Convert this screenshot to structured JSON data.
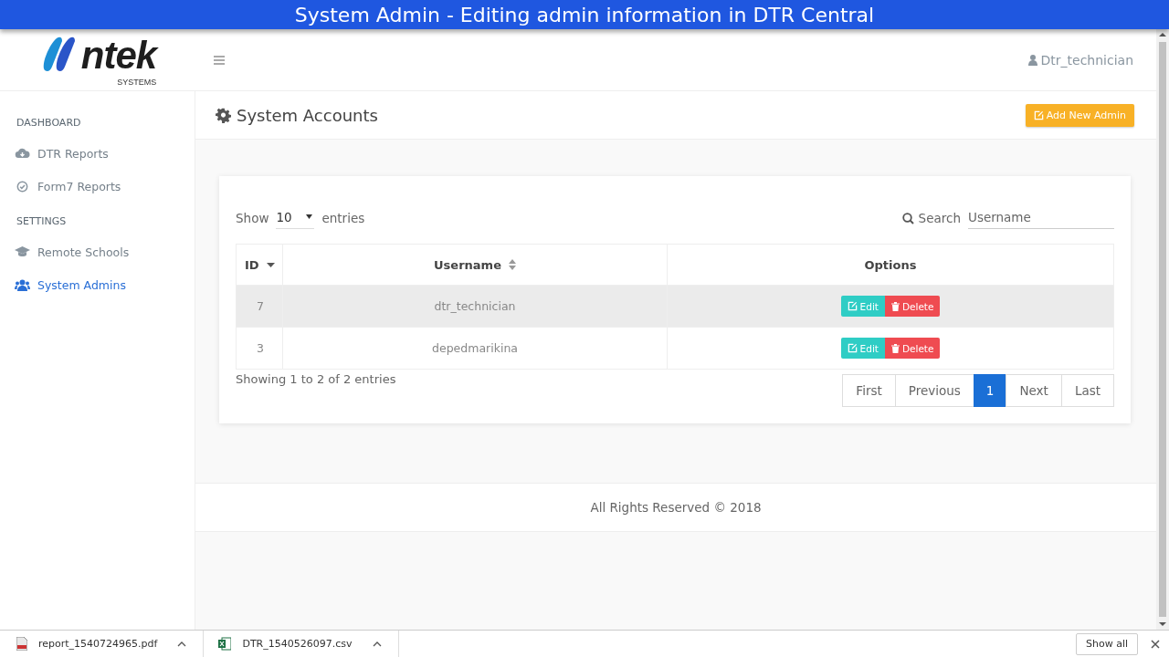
{
  "banner": {
    "title": "System Admin - Editing admin information in DTR Central"
  },
  "topbar": {
    "logo": "ntek",
    "logo_sub": "SYSTEMS",
    "user": "Dtr_technician"
  },
  "sidebar": {
    "sections": [
      {
        "heading": "DASHBOARD",
        "items": [
          {
            "label": "DTR Reports",
            "selected": false
          },
          {
            "label": "Form7 Reports",
            "selected": false
          }
        ]
      },
      {
        "heading": "SETTINGS",
        "items": [
          {
            "label": "Remote Schools",
            "selected": false
          },
          {
            "label": "System Admins",
            "selected": true
          }
        ]
      }
    ]
  },
  "page": {
    "title": "System Accounts",
    "add_button": "Add New Admin"
  },
  "table_controls": {
    "show_label": "Show",
    "page_size": "10",
    "entries_label": "entries",
    "search_label": "Search",
    "search_placeholder": "Username"
  },
  "table": {
    "columns": [
      {
        "label": "ID",
        "kind": "sorted"
      },
      {
        "label": "Username",
        "kind": "sortable"
      },
      {
        "label": "Options",
        "kind": "plain"
      }
    ],
    "rows": [
      {
        "id": "7",
        "username": "dtr_technician",
        "hovered": true,
        "edit": "Edit",
        "delete": "Delete"
      },
      {
        "id": "3",
        "username": "depedmarikina",
        "hovered": false,
        "edit": "Edit",
        "delete": "Delete"
      }
    ]
  },
  "table_info": "Showing 1 to 2 of 2 entries",
  "pagination": [
    {
      "label": "First",
      "selected": false
    },
    {
      "label": "Previous",
      "selected": false
    },
    {
      "label": "1",
      "selected": true
    },
    {
      "label": "Next",
      "selected": false
    },
    {
      "label": "Last",
      "selected": false
    }
  ],
  "footer": "All Rights Reserved © 2018",
  "downloads": {
    "files": [
      {
        "name": "report_1540724965.pdf",
        "kind": "document"
      },
      {
        "name": "DTR_1540526097.csv",
        "kind": "spreadsheet"
      }
    ],
    "show_all": "Show all"
  }
}
